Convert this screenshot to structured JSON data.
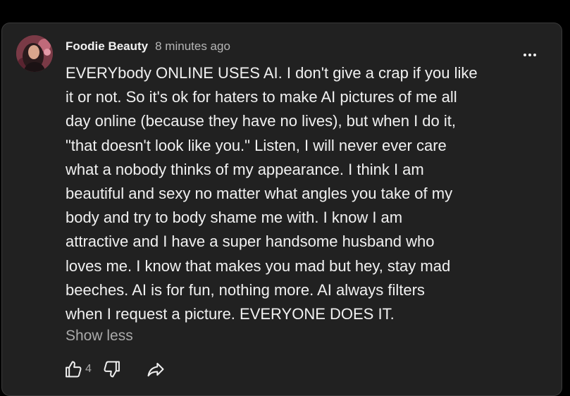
{
  "comment": {
    "author": "Foodie Beauty",
    "timestamp": "8 minutes ago",
    "text": "EVERYbody ONLINE USES AI. I don't give a crap if you like\nit or not. So it's ok for haters to make AI pictures of me all\nday online (because they have no lives), but when I do it,\n\"that doesn't look like you.\" Listen, I will never ever care\nwhat a nobody thinks of my appearance. I think I am\nbeautiful and sexy no matter what angles you take of my\nbody and try to body shame me with. I know I am\nattractive and I have a super handsome husband who\nloves me. I know that makes you mad but hey, stay mad\nbeeches.  AI is for fun, nothing more. AI always filters\nwhen I request a picture. EVERYONE DOES IT.",
    "show_less_label": "Show less",
    "like_count": "4"
  },
  "icons": {
    "avatar": "avatar-photo",
    "more": "more-vertical-icon",
    "like": "thumb-up-icon",
    "dislike": "thumb-down-icon",
    "share": "share-arrow-icon"
  },
  "colors": {
    "background": "#000000",
    "card": "#212121",
    "text_primary": "#f1f1f1",
    "text_secondary": "#aaaaaa"
  }
}
